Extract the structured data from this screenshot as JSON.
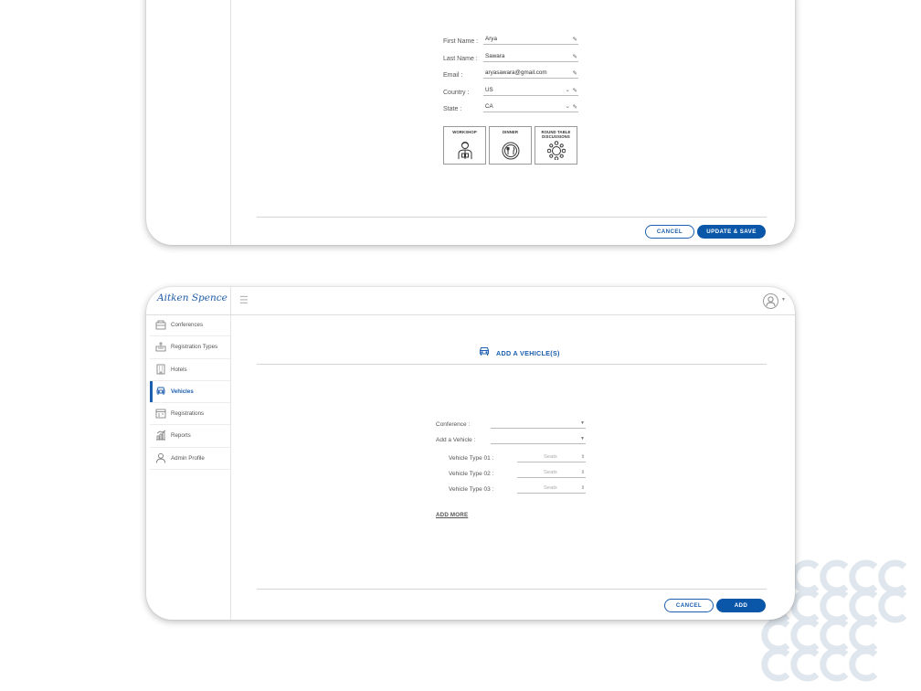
{
  "card1": {
    "form": {
      "first_name_label": "First Name :",
      "first_name_value": "Arya",
      "last_name_label": "Last Name :",
      "last_name_value": "Sawara",
      "email_label": "Email :",
      "email_value": "aryasawara@gmail.com",
      "country_label": "Country :",
      "country_value": "US",
      "state_label": "State :",
      "state_value": "CA"
    },
    "options": [
      {
        "label": "WORKSHOP",
        "icon": "person-icon"
      },
      {
        "label": "DINNER",
        "icon": "plate-cutlery-icon"
      },
      {
        "label": "ROUND TABLE DISCUSSIONS",
        "icon": "round-table-icon"
      }
    ],
    "buttons": {
      "cancel": "CANCEL",
      "update_save": "UPDATE & SAVE"
    }
  },
  "card2": {
    "brand": "Aitken Spence",
    "sidebar": {
      "items": [
        {
          "label": "Conferences",
          "icon": "conference-icon",
          "active": false
        },
        {
          "label": "Registration Types",
          "icon": "registration-type-icon",
          "active": false
        },
        {
          "label": "Hotels",
          "icon": "hotel-icon",
          "active": false
        },
        {
          "label": "Vehicles",
          "icon": "vehicle-icon",
          "active": true
        },
        {
          "label": "Registrations",
          "icon": "registrations-icon",
          "active": false
        },
        {
          "label": "Reports",
          "icon": "reports-icon",
          "active": false
        },
        {
          "label": "Admin Profile",
          "icon": "user-icon",
          "active": false
        }
      ]
    },
    "page_title": "ADD A VEHICLE(S)",
    "form": {
      "conference_label": "Conference :",
      "add_vehicle_label": "Add a Vehicle :",
      "vehicle_types": [
        {
          "label": "Vehicle Type 01 :",
          "placeholder": "Seats"
        },
        {
          "label": "Vehicle Type 02 :",
          "placeholder": "Seats"
        },
        {
          "label": "Vehicle Type 03 :",
          "placeholder": "Seats"
        }
      ],
      "add_more": "ADD MORE"
    },
    "buttons": {
      "cancel": "CANCEL",
      "add": "ADD"
    }
  },
  "colors": {
    "accent": "#1b5fae",
    "primary_button": "#0a56a8"
  }
}
